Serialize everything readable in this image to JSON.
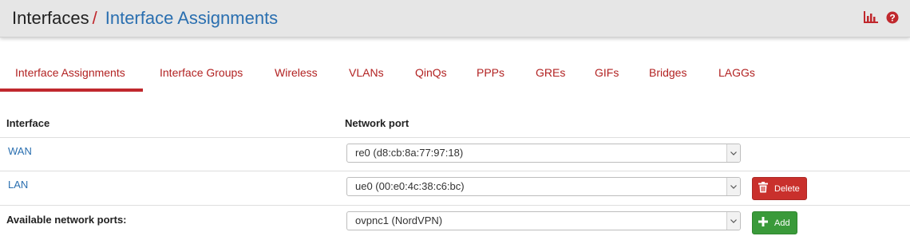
{
  "header": {
    "section": "Interfaces",
    "separator": "/",
    "current_page": "Interface Assignments",
    "icons": [
      "bar-chart-icon",
      "help-icon"
    ],
    "accent_color": "#c0282d",
    "link_color": "#2a6fb0"
  },
  "tabs": [
    {
      "label": "Interface Assignments",
      "active": true
    },
    {
      "label": "Interface Groups",
      "active": false
    },
    {
      "label": "Wireless",
      "active": false
    },
    {
      "label": "VLANs",
      "active": false
    },
    {
      "label": "QinQs",
      "active": false
    },
    {
      "label": "PPPs",
      "active": false
    },
    {
      "label": "GREs",
      "active": false
    },
    {
      "label": "GIFs",
      "active": false
    },
    {
      "label": "Bridges",
      "active": false
    },
    {
      "label": "LAGGs",
      "active": false
    }
  ],
  "table": {
    "headers": {
      "interface": "Interface",
      "network_port": "Network port"
    },
    "rows": [
      {
        "interface": "WAN",
        "port": "re0 (d8:cb:8a:77:97:18)"
      },
      {
        "interface": "LAN",
        "port": "ue0 (00:e0:4c:38:c6:bc)",
        "action": "Delete"
      }
    ],
    "available": {
      "label": "Available network ports:",
      "port": "ovpnc1 (NordVPN)",
      "action": "Add"
    }
  }
}
